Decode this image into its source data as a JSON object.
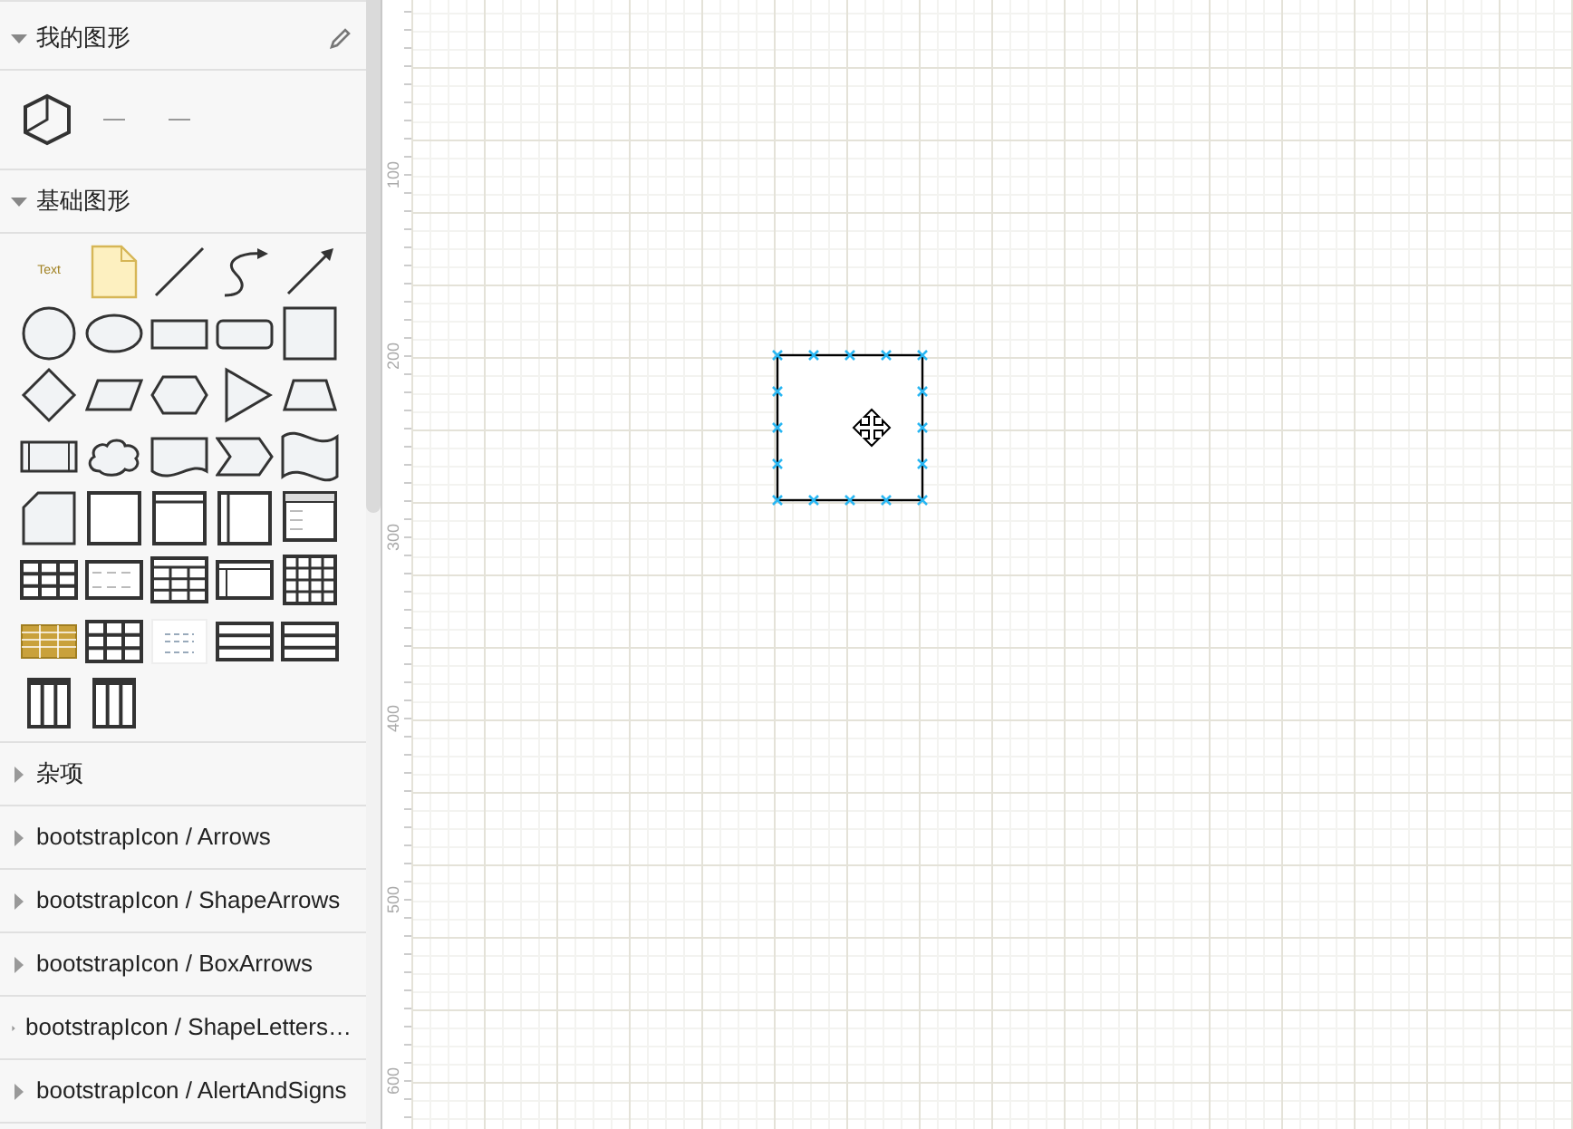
{
  "sidebar": {
    "sections": [
      {
        "title": "我的图形",
        "expanded": true,
        "editable": true,
        "shapes": [
          {
            "kind": "cube"
          },
          {
            "kind": "mini-line"
          },
          {
            "kind": "mini-line"
          }
        ]
      },
      {
        "title": "基础图形",
        "expanded": true,
        "editable": false,
        "shapes": [
          {
            "kind": "text",
            "label": "Text"
          },
          {
            "kind": "note"
          },
          {
            "kind": "line"
          },
          {
            "kind": "curve"
          },
          {
            "kind": "arrow"
          },
          {
            "kind": "circle"
          },
          {
            "kind": "ellipse"
          },
          {
            "kind": "rect"
          },
          {
            "kind": "rounded"
          },
          {
            "kind": "square"
          },
          {
            "kind": "diamond"
          },
          {
            "kind": "parallelogram"
          },
          {
            "kind": "hexagon"
          },
          {
            "kind": "triangle"
          },
          {
            "kind": "trapezoid"
          },
          {
            "kind": "process"
          },
          {
            "kind": "cloud"
          },
          {
            "kind": "document"
          },
          {
            "kind": "step"
          },
          {
            "kind": "tape"
          },
          {
            "kind": "card"
          },
          {
            "kind": "frame"
          },
          {
            "kind": "container"
          },
          {
            "kind": "swimlane"
          },
          {
            "kind": "list"
          },
          {
            "kind": "grid"
          },
          {
            "kind": "table-list"
          },
          {
            "kind": "table-header"
          },
          {
            "kind": "table-side"
          },
          {
            "kind": "table-thick"
          },
          {
            "kind": "table-gold"
          },
          {
            "kind": "grid-dark"
          },
          {
            "kind": "table-light"
          },
          {
            "kind": "rows"
          },
          {
            "kind": "rows"
          },
          {
            "kind": "columns"
          },
          {
            "kind": "columns"
          }
        ]
      },
      {
        "title": "杂项",
        "expanded": false,
        "editable": false
      },
      {
        "title": "bootstrapIcon / Arrows",
        "expanded": false,
        "editable": false
      },
      {
        "title": "bootstrapIcon / ShapeArrows",
        "expanded": false,
        "editable": false
      },
      {
        "title": "bootstrapIcon / BoxArrows",
        "expanded": false,
        "editable": false
      },
      {
        "title": "bootstrapIcon / ShapeLetters…",
        "expanded": false,
        "editable": false
      },
      {
        "title": "bootstrapIcon / AlertAndSigns",
        "expanded": false,
        "editable": false
      }
    ]
  },
  "ruler": {
    "labels": [
      "100",
      "200",
      "300",
      "400",
      "500",
      "600"
    ]
  },
  "canvas": {
    "shapes": [
      {
        "kind": "square",
        "selected": true
      }
    ]
  }
}
